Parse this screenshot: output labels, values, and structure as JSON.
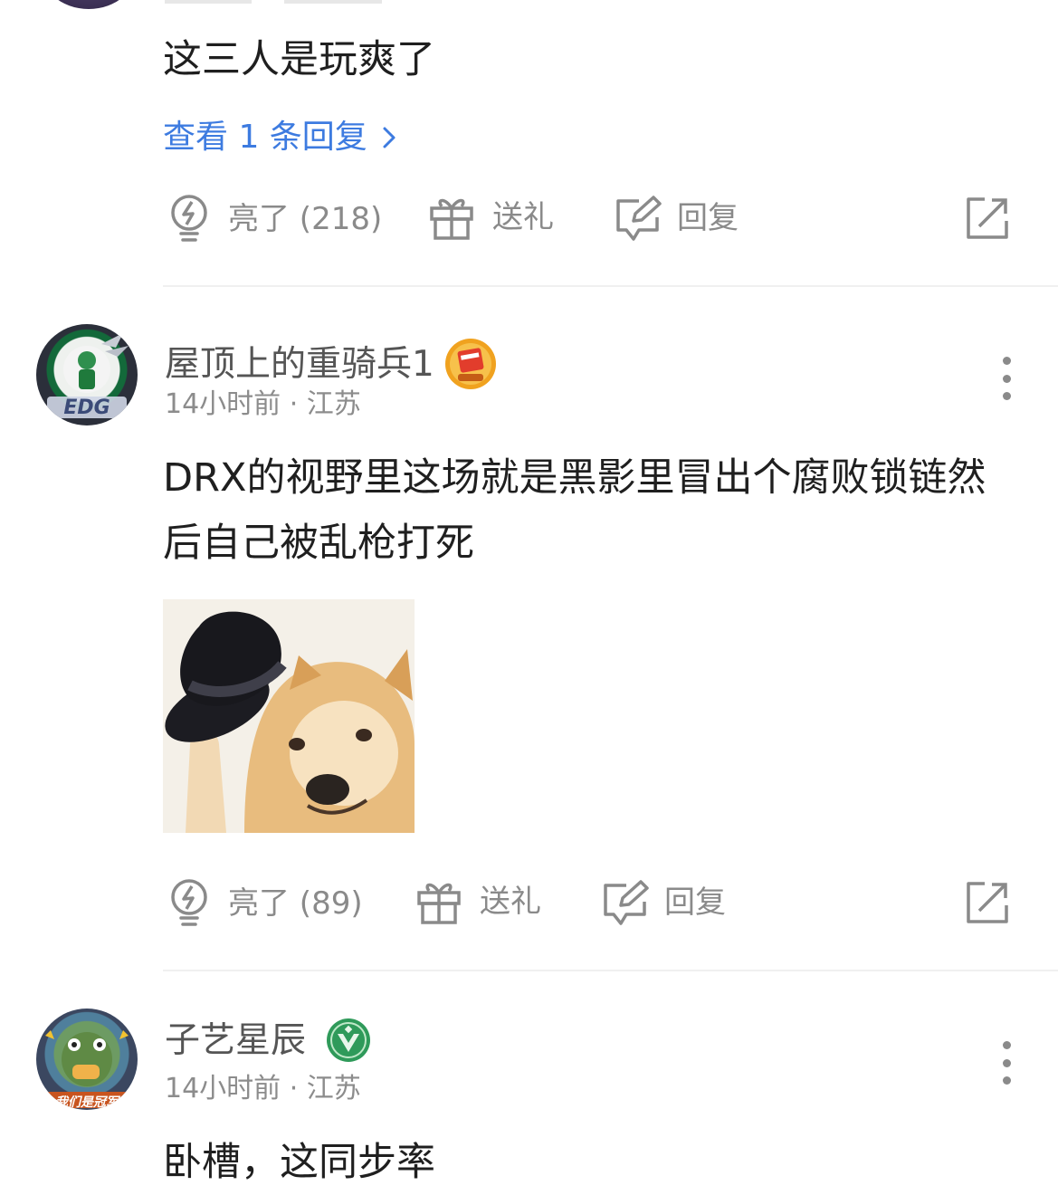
{
  "comment_top": {
    "content": "这三人是玩爽了",
    "view_replies": "查看 1 条回复",
    "actions": {
      "like": "亮了 (218)",
      "gift": "送礼",
      "reply": "回复"
    }
  },
  "comment_1": {
    "username": "屋顶上的重骑兵1",
    "avatar_text": "EDG",
    "meta": "14小时前 · 江苏",
    "content": "DRX的视野里这场就是黑影里冒出个腐败锁链然后自己被乱枪打死",
    "actions": {
      "like": "亮了 (89)",
      "gift": "送礼",
      "reply": "回复"
    }
  },
  "comment_2": {
    "username": "子艺星辰",
    "avatar_text": "我们是冠军",
    "meta": "14小时前 · 江苏",
    "content": "卧槽，这同步率"
  },
  "colors": {
    "link_blue": "#3d7be0",
    "meta_gray": "#8c8c8c",
    "action_gray": "#8a8a8a",
    "divider": "#f0f0f0"
  },
  "icons": {
    "like": "lightbulb-icon",
    "gift": "gift-icon",
    "reply": "edit-reply-icon",
    "share": "share-icon",
    "more": "more-vertical-icon"
  }
}
